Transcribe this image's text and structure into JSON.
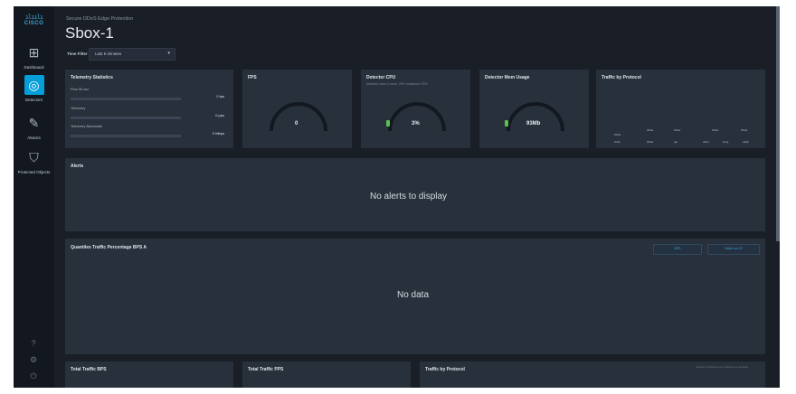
{
  "brand": {
    "bars": "ılıılı",
    "name": "CISCO"
  },
  "nav": [
    {
      "label": "Dashboard",
      "icon": "dashboard-icon",
      "glyph": "⊞"
    },
    {
      "label": "Detectors",
      "icon": "detector-icon",
      "glyph": "◎"
    },
    {
      "label": "Attacks",
      "icon": "attack-icon",
      "glyph": "✎"
    },
    {
      "label": "Protected Objects",
      "icon": "shield-icon",
      "glyph": "⛉"
    }
  ],
  "bottom_icons": [
    {
      "icon": "help-icon",
      "glyph": "?"
    },
    {
      "icon": "settings-icon",
      "glyph": "⚙"
    },
    {
      "icon": "logout-icon",
      "glyph": "⏻"
    }
  ],
  "header": {
    "subtitle": "Secure DDoS Edge Protection",
    "title": "Sbox-1",
    "time_filter_label": "Time Filter",
    "time_filter_value": "Last 5 minutes",
    "caret": "▾"
  },
  "telemetry": {
    "title": "Telemetry Statistics",
    "stats": [
      {
        "name": "Flow 50 sec",
        "value": "0 fps"
      },
      {
        "name": "Telemetry",
        "value": "0 pps"
      },
      {
        "name": "Telemetry Bandwidth",
        "value": "0 Mbps"
      }
    ]
  },
  "fps": {
    "title": "FPS",
    "value": "0"
  },
  "cpu": {
    "title": "Detector CPU",
    "subtitle": "Detector uses 2 cores, 20% maximum CPU",
    "value": "3%",
    "level": 0.03
  },
  "memory": {
    "title": "Detector Mem Usage",
    "value": "93Mb"
  },
  "traffic_protocol": {
    "title": "Traffic by Protocol",
    "labels_top": [
      "Other",
      "Other",
      "Other",
      "Other"
    ],
    "labels_bottom": [
      "Other",
      "Total",
      "Other",
      "tcp",
      "other",
      "icmp",
      "udp6"
    ]
  },
  "alerts": {
    "title": "Alerts",
    "message": "No alerts to display"
  },
  "quantiles": {
    "title": "Quantiles Traffic Percentage BPS A",
    "button1": "BPS",
    "button2": "Select an IO",
    "message": "No data"
  },
  "bottom_cards": {
    "total_bps": "Total Traffic BPS",
    "total_pps": "Total Traffic PPS",
    "traffic_protocol": "Traffic by Protocol",
    "note": "Activate Windows Go to Settings to activate."
  }
}
